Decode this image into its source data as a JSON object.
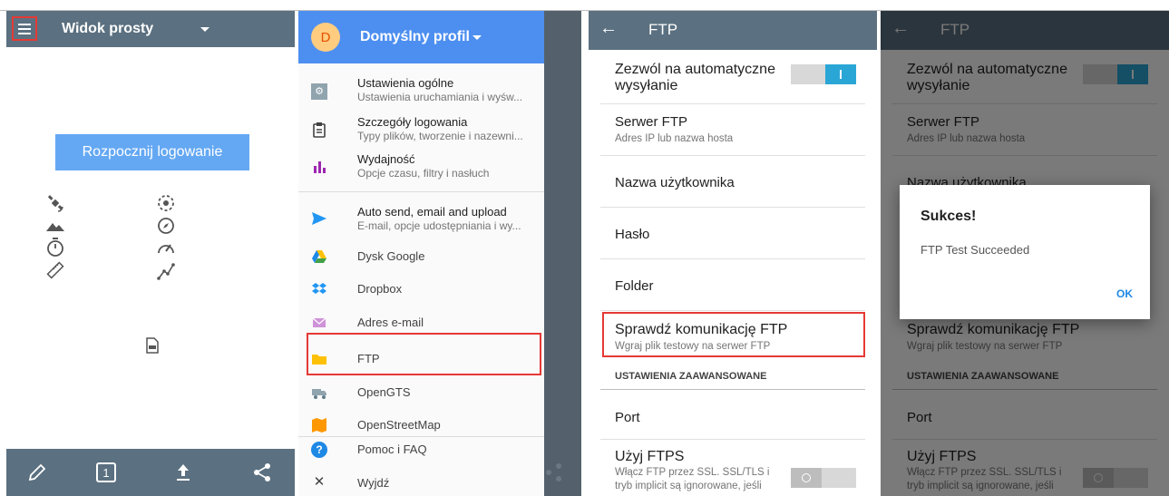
{
  "panel1": {
    "view_title": "Widok prosty",
    "start_button": "Rozpocznij logowanie",
    "status_icons": [
      "satellite-icon",
      "gps-fix-icon",
      "altitude-icon",
      "direction-icon",
      "timer-icon",
      "speed-icon",
      "distance-icon",
      "track-points-icon"
    ],
    "file_icon": "log-file-icon",
    "bottom_bar": [
      "edit-icon",
      "counter-icon",
      "upload-icon",
      "share-icon"
    ],
    "counter_value": "1"
  },
  "panel2": {
    "avatar_letter": "D",
    "profile_name": "Domyślny profil",
    "items": [
      {
        "title": "Ustawienia ogólne",
        "subtitle": "Ustawienia uruchamiania i wyśw..."
      },
      {
        "title": "Szczegóły logowania",
        "subtitle": "Typy plików, tworzenie i nazewni..."
      },
      {
        "title": "Wydajność",
        "subtitle": "Opcje czasu, filtry i nasłuch"
      },
      {
        "title": "Auto send, email and upload",
        "subtitle": "E-mail, opcje udostępniania i wy..."
      },
      {
        "title": "Dysk Google",
        "subtitle": ""
      },
      {
        "title": "Dropbox",
        "subtitle": ""
      },
      {
        "title": "Adres e-mail",
        "subtitle": ""
      },
      {
        "title": "FTP",
        "subtitle": ""
      },
      {
        "title": "OpenGTS",
        "subtitle": ""
      },
      {
        "title": "OpenStreetMap",
        "subtitle": ""
      },
      {
        "title": "Pomoc i FAQ",
        "subtitle": ""
      },
      {
        "title": "Wyjdź",
        "subtitle": ""
      }
    ],
    "icon_colors": {
      "ftp": "#ffc107",
      "send": "#2196f3",
      "chart": "#9c27b0"
    }
  },
  "ftp_settings": {
    "title": "FTP",
    "auto_send_l1": "Zezwól na automatyczne",
    "auto_send_l2": "wysyłanie",
    "server_title": "Serwer FTP",
    "server_sub": "Adres IP lub nazwa hosta",
    "username": "Nazwa użytkownika",
    "password": "Hasło",
    "folder": "Folder",
    "test_title": "Sprawdź komunikację FTP",
    "test_sub": "Wgraj plik testowy na serwer FTP",
    "advanced": "USTAWIENIA ZAAWANSOWANE",
    "port": "Port",
    "ftps_title": "Użyj FTPS",
    "ftps_sub_l1": "Włącz FTP przez SSL. SSL/TLS i",
    "ftps_sub_l2": "tryb implicit są ignorowane, jeśli"
  },
  "dialog": {
    "title": "Sukces!",
    "message": "FTP Test Succeeded",
    "ok": "OK"
  }
}
